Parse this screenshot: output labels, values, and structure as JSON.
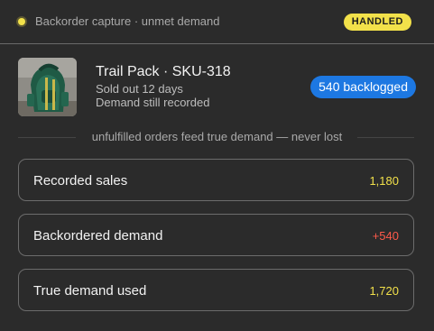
{
  "header": {
    "title": "Backorder capture · unmet demand",
    "status_badge": "HANDLED",
    "status_color": "#f2e14a"
  },
  "product": {
    "name": "Trail Pack · SKU-318",
    "line1": "Sold out 12 days",
    "line2": "Demand still recorded",
    "backlog_badge": "540 backlogged",
    "backlog_color": "#1d78e2",
    "image_icon": "backpack-photo"
  },
  "divider_text": "unfulfilled orders feed true demand — never lost",
  "metrics": [
    {
      "label": "Recorded sales",
      "value": "1,180",
      "color": "#f2e14a"
    },
    {
      "label": "Backordered demand",
      "value": "+540",
      "color": "#ff5a4a"
    },
    {
      "label": "True demand used",
      "value": "1,720",
      "color": "#f2e14a"
    }
  ]
}
